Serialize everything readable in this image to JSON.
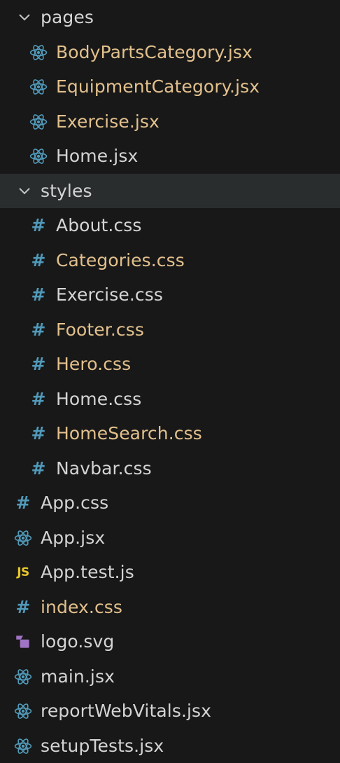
{
  "explorer": {
    "items": [
      {
        "label": "pages",
        "kind": "folder",
        "icon": "chevron-down-icon",
        "color": "#d4d4d4",
        "depth": 0
      },
      {
        "label": "BodyPartsCategory.jsx",
        "kind": "file",
        "icon": "react-icon",
        "color": "#e2c08d",
        "depth": 1
      },
      {
        "label": "EquipmentCategory.jsx",
        "kind": "file",
        "icon": "react-icon",
        "color": "#e2c08d",
        "depth": 1
      },
      {
        "label": "Exercise.jsx",
        "kind": "file",
        "icon": "react-icon",
        "color": "#e2c08d",
        "depth": 1
      },
      {
        "label": "Home.jsx",
        "kind": "file",
        "icon": "react-icon",
        "color": "#d4d4d4",
        "depth": 1
      },
      {
        "label": "styles",
        "kind": "folder",
        "icon": "chevron-down-icon",
        "color": "#d4d4d4",
        "depth": 0,
        "selected": true
      },
      {
        "label": "About.css",
        "kind": "file",
        "icon": "hash-icon",
        "color": "#d4d4d4",
        "depth": 1
      },
      {
        "label": "Categories.css",
        "kind": "file",
        "icon": "hash-icon",
        "color": "#e2c08d",
        "depth": 1
      },
      {
        "label": "Exercise.css",
        "kind": "file",
        "icon": "hash-icon",
        "color": "#d4d4d4",
        "depth": 1
      },
      {
        "label": "Footer.css",
        "kind": "file",
        "icon": "hash-icon",
        "color": "#e2c08d",
        "depth": 1
      },
      {
        "label": "Hero.css",
        "kind": "file",
        "icon": "hash-icon",
        "color": "#e2c08d",
        "depth": 1
      },
      {
        "label": "Home.css",
        "kind": "file",
        "icon": "hash-icon",
        "color": "#d4d4d4",
        "depth": 1
      },
      {
        "label": "HomeSearch.css",
        "kind": "file",
        "icon": "hash-icon",
        "color": "#e2c08d",
        "depth": 1
      },
      {
        "label": "Navbar.css",
        "kind": "file",
        "icon": "hash-icon",
        "color": "#d4d4d4",
        "depth": 1
      },
      {
        "label": "App.css",
        "kind": "file",
        "icon": "hash-icon",
        "color": "#d4d4d4",
        "depth": 0
      },
      {
        "label": "App.jsx",
        "kind": "file",
        "icon": "react-icon",
        "color": "#d4d4d4",
        "depth": 0
      },
      {
        "label": "App.test.js",
        "kind": "file",
        "icon": "js-icon",
        "icon_text": "JS",
        "color": "#d4d4d4",
        "depth": 0
      },
      {
        "label": "index.css",
        "kind": "file",
        "icon": "hash-icon",
        "color": "#e2c08d",
        "depth": 0
      },
      {
        "label": "logo.svg",
        "kind": "file",
        "icon": "svg-file-icon",
        "color": "#d4d4d4",
        "depth": 0
      },
      {
        "label": "main.jsx",
        "kind": "file",
        "icon": "react-icon",
        "color": "#d4d4d4",
        "depth": 0
      },
      {
        "label": "reportWebVitals.jsx",
        "kind": "file",
        "icon": "react-icon",
        "color": "#d4d4d4",
        "depth": 0
      },
      {
        "label": "setupTests.jsx",
        "kind": "file",
        "icon": "react-icon",
        "color": "#d4d4d4",
        "depth": 0
      }
    ]
  },
  "colors": {
    "background": "#181818",
    "selected_row": "#2a2d2e",
    "react_icon": "#519aba",
    "hash_icon": "#519aba",
    "js_icon": "#e8c62e",
    "svg_icon": "#a074c4"
  }
}
